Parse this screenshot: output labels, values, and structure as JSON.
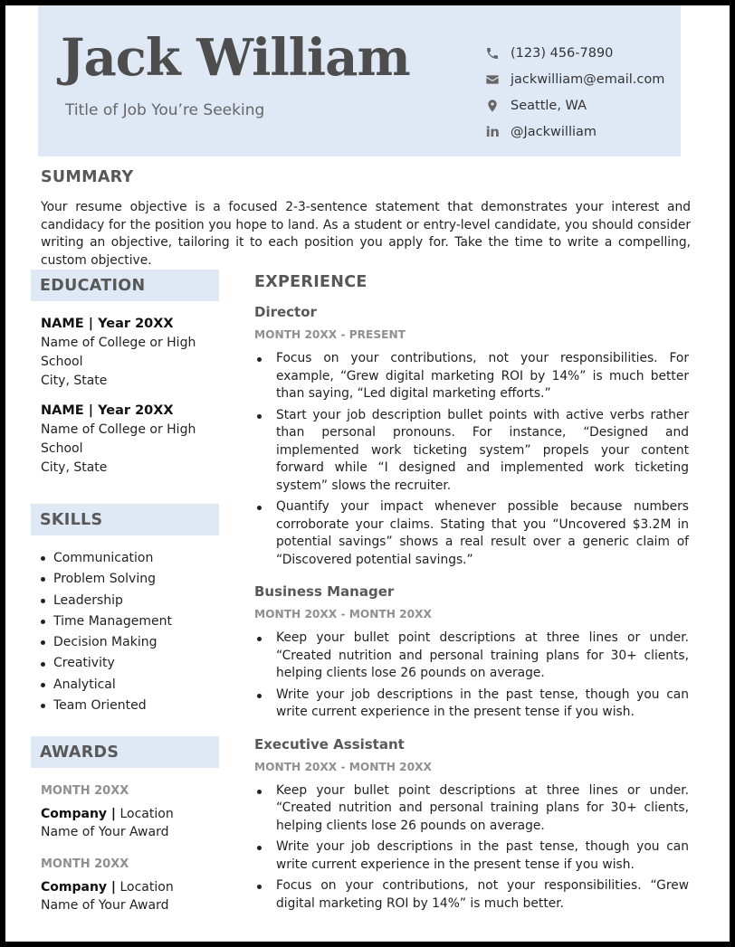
{
  "header": {
    "name": "Jack William",
    "job_title": "Title of Job You’re Seeking",
    "contacts": [
      {
        "icon": "phone-icon",
        "value": "(123) 456-7890"
      },
      {
        "icon": "envelope-icon",
        "value": "jackwilliam@email.com"
      },
      {
        "icon": "location-pin-icon",
        "value": "Seattle, WA"
      },
      {
        "icon": "linkedin-icon",
        "glyph": "in",
        "value": "@Jackwilliam"
      }
    ]
  },
  "summary": {
    "title": "SUMMARY",
    "text": "Your resume objective is a focused 2-3-sentence statement that demonstrates your interest and candidacy for the position you hope to land. As a student or entry-level candidate, you should consider writing an objective, tailoring it to each position you apply for. Take the time to write a compelling, custom objective."
  },
  "education": {
    "title": "EDUCATION",
    "entries": [
      {
        "name": "NAME | Year 20XX",
        "school": "Name of College or High School",
        "location": "City, State"
      },
      {
        "name": "NAME | Year 20XX",
        "school": "Name of College or High School",
        "location": "City, State"
      }
    ]
  },
  "skills": {
    "title": "SKILLS",
    "items": [
      "Communication",
      "Problem Solving",
      "Leadership",
      "Time Management",
      "Decision Making",
      "Creativity",
      "Analytical",
      "Team Oriented"
    ]
  },
  "awards": {
    "title": "AWARDS",
    "entries": [
      {
        "date": "MONTH 20XX",
        "company": "Company |",
        "location": "Location",
        "award": "Name of Your Award"
      },
      {
        "date": "MONTH 20XX",
        "company": "Company |",
        "location": "Location",
        "award": "Name of Your Award"
      }
    ]
  },
  "experience": {
    "title": "EXPERIENCE",
    "jobs": [
      {
        "role": "Director",
        "dates": "MONTH 20XX - PRESENT",
        "bullets": [
          "Focus on your contributions, not your responsibilities. For example, “Grew digital marketing ROI by 14%” is much better than saying, “Led digital marketing efforts.”",
          "Start your job description bullet points with active verbs rather than personal pronouns. For instance, “Designed and implemented work ticketing system” propels your content forward while “I designed and implemented work ticketing system” slows the recruiter.",
          "Quantify your impact whenever possible because numbers corroborate your claims. Stating that you “Uncovered $3.2M in potential savings” shows a real result over a generic claim of “Discovered potential savings.”"
        ]
      },
      {
        "role": "Business Manager",
        "dates": "MONTH 20XX - MONTH 20XX",
        "bullets": [
          "Keep your bullet point descriptions at three lines or under. “Created nutrition and personal training plans for 30+ clients, helping clients lose 26 pounds on average.",
          "Write your job descriptions in the past tense, though you can write current experience in the present tense if you wish."
        ]
      },
      {
        "role": "Executive Assistant",
        "dates": "MONTH 20XX - MONTH 20XX",
        "bullets": [
          "Keep your bullet point descriptions at three lines or under. “Created nutrition and personal training plans for 30+ clients, helping clients lose 26 pounds on average.",
          "Write your job descriptions in the past tense, though you can write current experience in the present tense if you wish.",
          "Focus on your contributions, not your responsibilities. “Grew digital marketing ROI by 14%” is much better."
        ]
      }
    ]
  },
  "colors": {
    "accent_background": "#dfe9f5",
    "heading_gray": "#585858",
    "date_gray": "#8f8f8f"
  }
}
